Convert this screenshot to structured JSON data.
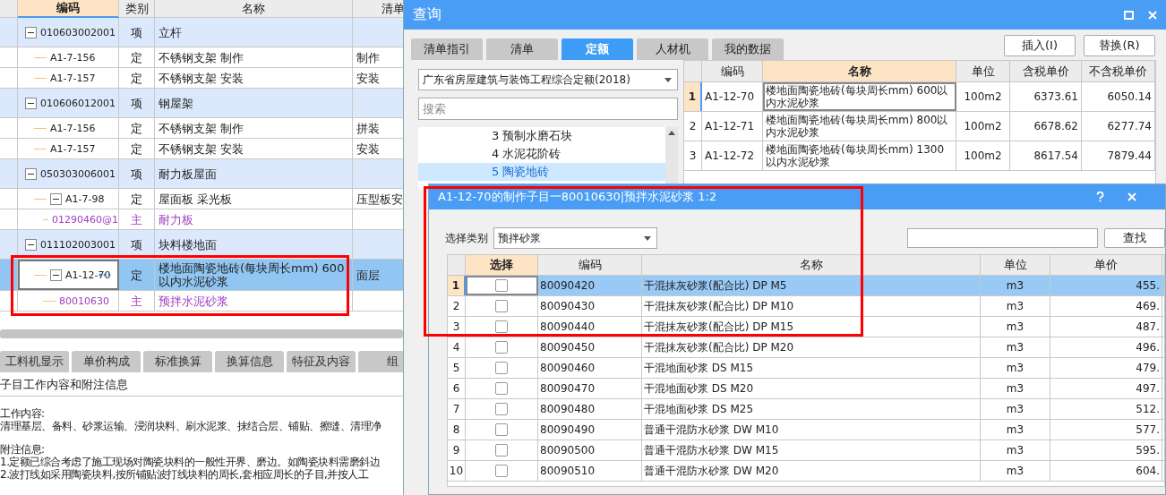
{
  "main_table": {
    "columns": [
      "编码",
      "类别",
      "名称",
      "清单"
    ],
    "rows": [
      {
        "kind": "item",
        "code": "010603002001",
        "type": "项",
        "name": "立杆",
        "expanded": true,
        "selected": false,
        "children": [
          {
            "kind": "quota",
            "code": "A1-7-156",
            "type": "定",
            "name": "不锈钢支架 制作",
            "work": "制作",
            "selected": false
          },
          {
            "kind": "quota",
            "code": "A1-7-157",
            "type": "定",
            "name": "不锈钢支架 安装",
            "work": "安装",
            "selected": false
          }
        ]
      },
      {
        "kind": "item",
        "code": "010606012001",
        "type": "项",
        "name": "钢屋架",
        "expanded": true,
        "selected": false,
        "children": [
          {
            "kind": "quota",
            "code": "A1-7-156",
            "type": "定",
            "name": "不锈钢支架 制作",
            "work": "拼装",
            "selected": false
          },
          {
            "kind": "quota",
            "code": "A1-7-157",
            "type": "定",
            "name": "不锈钢支架 安装",
            "work": "安装",
            "selected": false
          }
        ]
      },
      {
        "kind": "item",
        "code": "050303006001",
        "type": "项",
        "name": "耐力板屋面",
        "expanded": true,
        "selected": false,
        "children": [
          {
            "kind": "quota",
            "code": "A1-7-98",
            "type": "定",
            "name": "屋面板 采光板",
            "work": "压型板安",
            "expanded": true,
            "selected": false,
            "children": [
              {
                "kind": "material",
                "code": "01290460@1",
                "type": "主",
                "name": "耐力板",
                "selected": false
              }
            ]
          }
        ]
      },
      {
        "kind": "item",
        "code": "011102003001",
        "type": "项",
        "name": "块料楼地面",
        "expanded": true,
        "selected": false,
        "children": [
          {
            "kind": "quota",
            "code": "A1-12-70",
            "type": "定",
            "name": "楼地面陶瓷地砖(每块周长mm) 600以内水泥砂浆",
            "work": "面层",
            "expanded": true,
            "selected": true,
            "children": [
              {
                "kind": "material",
                "code": "80010630",
                "type": "主",
                "name": "预拌水泥砂浆",
                "selected": false
              }
            ]
          }
        ]
      }
    ]
  },
  "bottom_tabs": [
    {
      "label": "工料机显示",
      "selected": false
    },
    {
      "label": "单价构成",
      "selected": false
    },
    {
      "label": "标准换算",
      "selected": false
    },
    {
      "label": "换算信息",
      "selected": false
    },
    {
      "label": "特征及内容",
      "selected": false
    },
    {
      "label": "组",
      "selected": false
    }
  ],
  "info": {
    "heading": "子目工作内容和附注信息",
    "work_title": "工作内容:",
    "work_text": "清理基层、备料、砂浆运输、浸润块料、刷水泥浆、抹结合层、铺贴、擦缝、清理净",
    "notes_title": "附注信息:",
    "notes": [
      "1.定额已综合考虑了施工现场对陶瓷块料的一般性开界、磨边。如陶瓷块料需磨斜边",
      "2.波打线如采用陶瓷块料,按所铺贴波打线块料的周长,套相应周长的子目,并按人工"
    ]
  },
  "query_window": {
    "title": "查询",
    "tabs": [
      {
        "label": "清单指引",
        "selected": false
      },
      {
        "label": "清单",
        "selected": false
      },
      {
        "label": "定额",
        "selected": true
      },
      {
        "label": "人材机",
        "selected": false
      },
      {
        "label": "我的数据",
        "selected": false
      }
    ],
    "buttons": [
      "插入(I)",
      "替换(R)"
    ],
    "library": "广东省房屋建筑与装饰工程综合定额(2018)",
    "search": {
      "placeholder": "搜索"
    },
    "tree_items": [
      {
        "label": "3 预制水磨石块",
        "selected": false
      },
      {
        "label": "4 水泥花阶砖",
        "selected": false
      },
      {
        "label": "5 陶瓷地砖",
        "selected": true
      }
    ],
    "table": {
      "columns": [
        "编码",
        "名称",
        "单位",
        "含税单价",
        "不含税单价"
      ],
      "rows": [
        {
          "index": "1",
          "code": "A1-12-70",
          "name": "楼地面陶瓷地砖(每块周长mm) 600以内水泥砂浆",
          "unit": "100m2",
          "price_tax": "6373.61",
          "price_notax": "6050.14",
          "selected": true
        },
        {
          "index": "2",
          "code": "A1-12-71",
          "name": "楼地面陶瓷地砖(每块周长mm) 800以内水泥砂浆",
          "unit": "100m2",
          "price_tax": "6678.62",
          "price_notax": "6277.74",
          "selected": false
        },
        {
          "index": "3",
          "code": "A1-12-72",
          "name": "楼地面陶瓷地砖(每块周长mm) 1300以内水泥砂浆",
          "unit": "100m2",
          "price_tax": "8617.54",
          "price_notax": "7879.44",
          "selected": false
        }
      ]
    }
  },
  "sub_dialog": {
    "title": "A1-12-70的制作子目一80010630|预拌水泥砂浆 1:2",
    "category_label": "选择类别",
    "category": "预拌砂浆",
    "find_button": "查找",
    "columns": [
      "选择",
      "编码",
      "名称",
      "单位",
      "单价"
    ],
    "rows": [
      {
        "index": "1",
        "checked": false,
        "code": "80090420",
        "name": "干混抹灰砂浆(配合比) DP M5",
        "unit": "m3",
        "price": "455.",
        "selected": true
      },
      {
        "index": "2",
        "checked": false,
        "code": "80090430",
        "name": "干混抹灰砂浆(配合比) DP M10",
        "unit": "m3",
        "price": "469.",
        "selected": false
      },
      {
        "index": "3",
        "checked": false,
        "code": "80090440",
        "name": "干混抹灰砂浆(配合比) DP M15",
        "unit": "m3",
        "price": "487.",
        "selected": false
      },
      {
        "index": "4",
        "checked": false,
        "code": "80090450",
        "name": "干混抹灰砂浆(配合比) DP M20",
        "unit": "m3",
        "price": "496.",
        "selected": false
      },
      {
        "index": "5",
        "checked": false,
        "code": "80090460",
        "name": "干混地面砂浆 DS M15",
        "unit": "m3",
        "price": "479.",
        "selected": false
      },
      {
        "index": "6",
        "checked": false,
        "code": "80090470",
        "name": "干混地面砂浆 DS M20",
        "unit": "m3",
        "price": "497.",
        "selected": false
      },
      {
        "index": "7",
        "checked": false,
        "code": "80090480",
        "name": "干混地面砂浆 DS M25",
        "unit": "m3",
        "price": "512.",
        "selected": false
      },
      {
        "index": "8",
        "checked": false,
        "code": "80090490",
        "name": "普通干混防水砂浆 DW M10",
        "unit": "m3",
        "price": "577.",
        "selected": false
      },
      {
        "index": "9",
        "checked": false,
        "code": "80090500",
        "name": "普通干混防水砂浆 DW M15",
        "unit": "m3",
        "price": "595.",
        "selected": false
      },
      {
        "index": "10",
        "checked": false,
        "code": "80090510",
        "name": "普通干混防水砂浆 DW M20",
        "unit": "m3",
        "price": "604.",
        "selected": false
      }
    ]
  }
}
